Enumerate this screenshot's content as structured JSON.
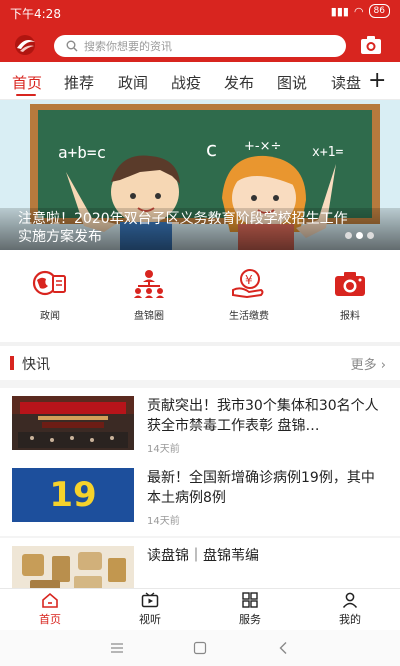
{
  "status_bar": {
    "time": "下午4:28",
    "battery": "86"
  },
  "search": {
    "placeholder": "搜索你想要的资讯"
  },
  "tabs": [
    {
      "label": "首页",
      "active": true
    },
    {
      "label": "推荐"
    },
    {
      "label": "政闻"
    },
    {
      "label": "战疫"
    },
    {
      "label": "发布"
    },
    {
      "label": "图说"
    },
    {
      "label": "读盘"
    }
  ],
  "banner": {
    "caption": "注意啦！2020年双台子区义务教育阶段学校招生工作实施方案发布",
    "chalk_text": [
      "a+b=c",
      "c",
      "+-×÷",
      "x+1="
    ]
  },
  "quick_menu": [
    {
      "label": "政闻",
      "icon": "globe-doc-icon"
    },
    {
      "label": "盘锦圈",
      "icon": "network-icon"
    },
    {
      "label": "生活缴费",
      "icon": "yen-hand-icon"
    },
    {
      "label": "报料",
      "icon": "camera-icon"
    }
  ],
  "section": {
    "title": "快讯",
    "more": "更多"
  },
  "news": [
    {
      "title": "贡献突出！我市30个集体和30名个人获全市禁毒工作表彰 盘锦…",
      "time": "14天前"
    },
    {
      "title": "最新！全国新增确诊病例19例，其中本土病例8例",
      "time": "14天前",
      "thumb_number": "19"
    },
    {
      "title": "读盘锦｜盘锦苇编",
      "time": ""
    }
  ],
  "bottom_nav": [
    {
      "label": "首页",
      "active": true
    },
    {
      "label": "视听"
    },
    {
      "label": "服务"
    },
    {
      "label": "我的"
    }
  ],
  "colors": {
    "brand": "#d8251f"
  }
}
